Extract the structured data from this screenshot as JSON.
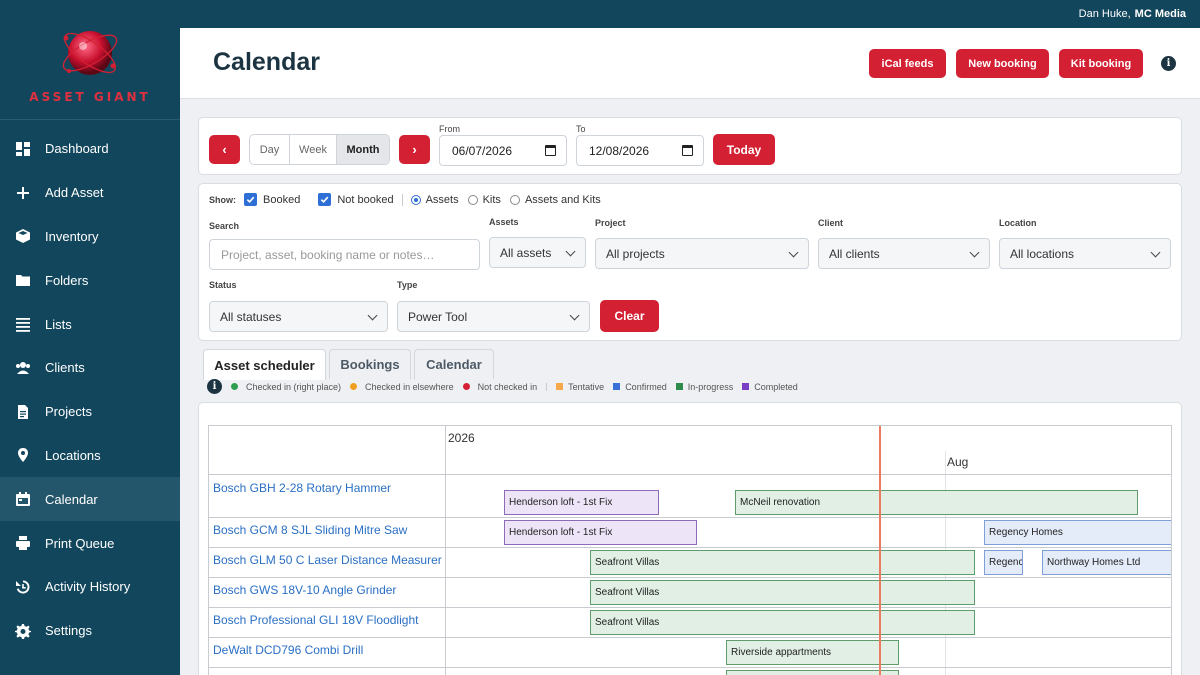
{
  "user": {
    "name": "Dan Huke,",
    "org": "MC Media"
  },
  "brand": {
    "name": "ASSET GIANT"
  },
  "sidebar": {
    "items": [
      {
        "label": "Dashboard",
        "icon": "dashboard-icon"
      },
      {
        "label": "Add Asset",
        "icon": "plus-icon"
      },
      {
        "label": "Inventory",
        "icon": "box-icon"
      },
      {
        "label": "Folders",
        "icon": "folder-icon"
      },
      {
        "label": "Lists",
        "icon": "list-icon"
      },
      {
        "label": "Clients",
        "icon": "clients-icon"
      },
      {
        "label": "Projects",
        "icon": "document-icon"
      },
      {
        "label": "Locations",
        "icon": "map-pin-icon"
      },
      {
        "label": "Calendar",
        "icon": "calendar-icon",
        "active": true
      },
      {
        "label": "Print Queue",
        "icon": "printer-icon"
      },
      {
        "label": "Activity History",
        "icon": "history-icon"
      },
      {
        "label": "Settings",
        "icon": "gear-icon"
      }
    ]
  },
  "header": {
    "title": "Calendar",
    "buttons": {
      "ical": "iCal feeds",
      "new_booking": "New booking",
      "kit_booking": "Kit booking"
    },
    "info": "i"
  },
  "toolbar": {
    "prev": "‹",
    "next": "›",
    "views": [
      "Day",
      "Week",
      "Month"
    ],
    "active_view": "Month",
    "from_label": "From",
    "from_value": "06/07/2026",
    "to_label": "To",
    "to_value": "12/08/2026",
    "today": "Today"
  },
  "filters": {
    "show_label": "Show:",
    "booked": "Booked",
    "not_booked": "Not booked",
    "assets": "Assets",
    "kits": "Kits",
    "assets_and_kits": "Assets and Kits",
    "search_label": "Search",
    "search_placeholder": "Project, asset, booking name or notes…",
    "assets_label": "Assets",
    "assets_value": "All assets",
    "project_label": "Project",
    "project_value": "All projects",
    "client_label": "Client",
    "client_value": "All clients",
    "location_label": "Location",
    "location_value": "All locations",
    "status_label": "Status",
    "status_value": "All statuses",
    "type_label": "Type",
    "type_value": "Power Tool",
    "clear": "Clear"
  },
  "tabs": [
    "Asset scheduler",
    "Bookings",
    "Calendar"
  ],
  "legend": {
    "info": "i",
    "items": [
      {
        "label": "Checked in (right place)",
        "color": "#2e9e4f",
        "shape": "dot"
      },
      {
        "label": "Checked in elsewhere",
        "color": "#f0a020",
        "shape": "dot"
      },
      {
        "label": "Not checked in",
        "color": "#d42033",
        "shape": "dot"
      },
      {
        "label": "Tentative",
        "color": "#f5a94a",
        "shape": "square"
      },
      {
        "label": "Confirmed",
        "color": "#3a6fd8",
        "shape": "square"
      },
      {
        "label": "In-progress",
        "color": "#2e8b4a",
        "shape": "square"
      },
      {
        "label": "Completed",
        "color": "#7a3fc4",
        "shape": "square"
      }
    ]
  },
  "scheduler": {
    "year": "2026",
    "month": "Aug",
    "rows": [
      {
        "name": "Bosch GBH 2-28 Rotary Hammer"
      },
      {
        "name": "Bosch GCM 8 SJL Sliding Mitre Saw"
      },
      {
        "name": "Bosch GLM 50 C Laser Distance Measurer"
      },
      {
        "name": "Bosch GWS 18V-10 Angle Grinder"
      },
      {
        "name": "Bosch Professional GLI 18V Floodlight"
      },
      {
        "name": "DeWalt DCD796 Combi Drill"
      }
    ],
    "bookings": {
      "b1": "Henderson loft - 1st Fix",
      "b2": "McNeil renovation",
      "b3": "Henderson loft - 1st Fix",
      "b4": "Regency Homes",
      "b5": "Seafront Villas",
      "b6": "Regency Homes",
      "b7": "Northway Homes Ltd",
      "b8": "Seafront Villas",
      "b9": "Seafront Villas",
      "b10": "Riverside appartments"
    }
  }
}
